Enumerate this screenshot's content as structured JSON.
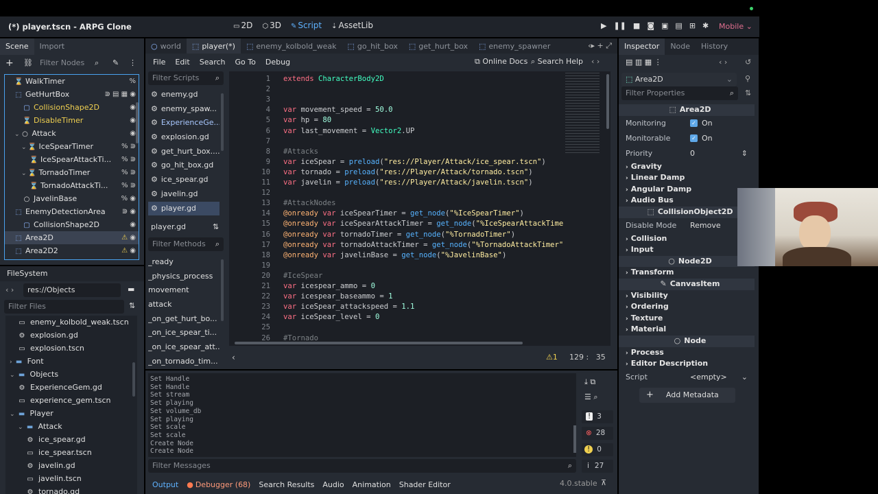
{
  "window": {
    "title": "(*) player.tscn - ARPG Clone"
  },
  "modes": [
    "2D",
    "3D",
    "Script",
    "AssetLib"
  ],
  "active_mode": "Script",
  "renderer": "Mobile",
  "left_tabs": {
    "scene": "Scene",
    "import": "Import"
  },
  "scene_filter": "Filter Nodes",
  "scene_nodes": [
    {
      "label": "WalkTimer",
      "indent": 1,
      "type": "timer",
      "color": "normal",
      "right": "%"
    },
    {
      "label": "GetHurtBox",
      "indent": 1,
      "type": "area",
      "color": "normal",
      "right": "signal sig-group film eye"
    },
    {
      "label": "CollisionShape2D",
      "indent": 2,
      "type": "shape",
      "color": "yellow",
      "right": "eye"
    },
    {
      "label": "DisableTimer",
      "indent": 2,
      "type": "timer",
      "color": "yellow",
      "right": "eye"
    },
    {
      "label": "Attack",
      "indent": 1,
      "type": "node",
      "color": "normal",
      "right": "eye"
    },
    {
      "label": "IceSpearTimer",
      "indent": 2,
      "type": "timer",
      "color": "normal",
      "right": "% signal"
    },
    {
      "label": "IceSpearAttackTi...",
      "indent": 3,
      "type": "timer",
      "color": "normal",
      "right": "% signal"
    },
    {
      "label": "TornadoTimer",
      "indent": 2,
      "type": "timer",
      "color": "normal",
      "right": "% signal"
    },
    {
      "label": "TornadoAttackTi...",
      "indent": 3,
      "type": "timer",
      "color": "normal",
      "right": "% signal"
    },
    {
      "label": "JavelinBase",
      "indent": 2,
      "type": "node",
      "color": "normal",
      "right": "% eye"
    },
    {
      "label": "EnemyDetectionArea",
      "indent": 1,
      "type": "area",
      "color": "normal",
      "right": "signal eye"
    },
    {
      "label": "CollisionShape2D",
      "indent": 2,
      "type": "shape",
      "color": "normal",
      "right": "eye"
    },
    {
      "label": "Area2D",
      "indent": 1,
      "type": "area",
      "color": "normal",
      "right": "warn eye",
      "selected": true
    },
    {
      "label": "Area2D2",
      "indent": 1,
      "type": "area",
      "color": "normal",
      "right": "warn eye"
    }
  ],
  "filesystem": {
    "title": "FileSystem",
    "path": "res://Objects",
    "filter": "Filter Files",
    "items": [
      {
        "label": "enemy_kolbold_weak.tscn",
        "indent": 2,
        "type": "scene"
      },
      {
        "label": "explosion.gd",
        "indent": 2,
        "type": "gear"
      },
      {
        "label": "explosion.tscn",
        "indent": 2,
        "type": "scene"
      },
      {
        "label": "Font",
        "indent": 1,
        "type": "folder",
        "arrow": ">"
      },
      {
        "label": "Objects",
        "indent": 1,
        "type": "folder",
        "arrow": "v"
      },
      {
        "label": "ExperienceGem.gd",
        "indent": 2,
        "type": "gear"
      },
      {
        "label": "experience_gem.tscn",
        "indent": 2,
        "type": "scene"
      },
      {
        "label": "Player",
        "indent": 1,
        "type": "folder",
        "arrow": "v"
      },
      {
        "label": "Attack",
        "indent": 2,
        "type": "folder",
        "arrow": "v"
      },
      {
        "label": "ice_spear.gd",
        "indent": 3,
        "type": "gear"
      },
      {
        "label": "ice_spear.tscn",
        "indent": 3,
        "type": "scene"
      },
      {
        "label": "javelin.gd",
        "indent": 3,
        "type": "gear"
      },
      {
        "label": "javelin.tscn",
        "indent": 3,
        "type": "scene"
      },
      {
        "label": "tornado.gd",
        "indent": 3,
        "type": "gear"
      }
    ]
  },
  "editor_tabs": [
    "world",
    "player(*)",
    "enemy_kolbold_weak",
    "go_hit_box",
    "get_hurt_box",
    "enemy_spawner"
  ],
  "menu": [
    "File",
    "Edit",
    "Search",
    "Go To",
    "Debug"
  ],
  "online_docs": "Online Docs",
  "search_help": "Search Help",
  "filter_scripts": "Filter Scripts",
  "scripts": [
    "enemy.gd",
    "enemy_spaw...",
    "ExperienceGe...",
    "explosion.gd",
    "get_hurt_box....",
    "go_hit_box.gd",
    "ice_spear.gd",
    "javelin.gd",
    "player.gd"
  ],
  "current_script": "player.gd",
  "filter_methods": "Filter Methods",
  "methods": [
    "_ready",
    "_physics_process",
    "movement",
    "attack",
    "_on_get_hurt_bo...",
    "_on_ice_spear_ti...",
    "_on_ice_spear_att...",
    "_on_tornado_tim..."
  ],
  "code_lines": [
    {
      "n": "1",
      "t": [
        [
          "kw",
          "extends "
        ],
        [
          "cls",
          "CharacterBody2D"
        ]
      ]
    },
    {
      "n": "2",
      "t": []
    },
    {
      "n": "3",
      "t": []
    },
    {
      "n": "4",
      "t": [
        [
          "kw",
          "var "
        ],
        [
          "",
          "movement_speed = "
        ],
        [
          "num",
          "50.0"
        ]
      ]
    },
    {
      "n": "5",
      "t": [
        [
          "kw",
          "var "
        ],
        [
          "",
          "hp = "
        ],
        [
          "num",
          "80"
        ]
      ]
    },
    {
      "n": "6",
      "t": [
        [
          "kw",
          "var "
        ],
        [
          "",
          "last_movement = "
        ],
        [
          "cls",
          "Vector2"
        ],
        [
          "",
          ".UP"
        ]
      ]
    },
    {
      "n": "7",
      "t": []
    },
    {
      "n": "8",
      "t": [
        [
          "cm",
          "#Attacks"
        ]
      ]
    },
    {
      "n": "9",
      "t": [
        [
          "kw",
          "var "
        ],
        [
          "",
          "iceSpear = "
        ],
        [
          "fn",
          "preload"
        ],
        [
          "",
          "("
        ],
        [
          "str",
          "\"res://Player/Attack/ice_spear.tscn\""
        ],
        [
          "",
          ")"
        ]
      ]
    },
    {
      "n": "10",
      "t": [
        [
          "kw",
          "var "
        ],
        [
          "",
          "tornado = "
        ],
        [
          "fn",
          "preload"
        ],
        [
          "",
          "("
        ],
        [
          "str",
          "\"res://Player/Attack/tornado.tscn\""
        ],
        [
          "",
          ")"
        ]
      ]
    },
    {
      "n": "11",
      "t": [
        [
          "kw",
          "var "
        ],
        [
          "",
          "javelin = "
        ],
        [
          "fn",
          "preload"
        ],
        [
          "",
          "("
        ],
        [
          "str",
          "\"res://Player/Attack/javelin.tscn\""
        ],
        [
          "",
          ")"
        ]
      ]
    },
    {
      "n": "12",
      "t": []
    },
    {
      "n": "13",
      "t": [
        [
          "cm",
          "#AttackNodes"
        ]
      ]
    },
    {
      "n": "14",
      "t": [
        [
          "anno",
          "@onready "
        ],
        [
          "kw",
          "var "
        ],
        [
          "",
          "iceSpearTimer = "
        ],
        [
          "fn",
          "get_node"
        ],
        [
          "",
          "("
        ],
        [
          "str",
          "\"%IceSpearTimer\""
        ],
        [
          "",
          ")"
        ]
      ]
    },
    {
      "n": "15",
      "t": [
        [
          "anno",
          "@onready "
        ],
        [
          "kw",
          "var "
        ],
        [
          "",
          "iceSpearAttackTimer = "
        ],
        [
          "fn",
          "get_node"
        ],
        [
          "",
          "("
        ],
        [
          "str",
          "\"%IceSpearAttackTime"
        ]
      ]
    },
    {
      "n": "16",
      "t": [
        [
          "anno",
          "@onready "
        ],
        [
          "kw",
          "var "
        ],
        [
          "",
          "tornadoTimer = "
        ],
        [
          "fn",
          "get_node"
        ],
        [
          "",
          "("
        ],
        [
          "str",
          "\"%TornadoTimer\""
        ],
        [
          "",
          ")"
        ]
      ]
    },
    {
      "n": "17",
      "t": [
        [
          "anno",
          "@onready "
        ],
        [
          "kw",
          "var "
        ],
        [
          "",
          "tornadoAttackTimer = "
        ],
        [
          "fn",
          "get_node"
        ],
        [
          "",
          "("
        ],
        [
          "str",
          "\"%TornadoAttackTimer\""
        ]
      ]
    },
    {
      "n": "18",
      "t": [
        [
          "anno",
          "@onready "
        ],
        [
          "kw",
          "var "
        ],
        [
          "",
          "javelinBase = "
        ],
        [
          "fn",
          "get_node"
        ],
        [
          "",
          "("
        ],
        [
          "str",
          "\"%JavelinBase\""
        ],
        [
          "",
          ")"
        ]
      ]
    },
    {
      "n": "19",
      "t": []
    },
    {
      "n": "20",
      "t": [
        [
          "cm",
          "#IceSpear"
        ]
      ]
    },
    {
      "n": "21",
      "t": [
        [
          "kw",
          "var "
        ],
        [
          "",
          "icespear_ammo = "
        ],
        [
          "num",
          "0"
        ]
      ]
    },
    {
      "n": "22",
      "t": [
        [
          "kw",
          "var "
        ],
        [
          "",
          "icespear_baseammo = "
        ],
        [
          "num",
          "1"
        ]
      ]
    },
    {
      "n": "23",
      "t": [
        [
          "kw",
          "var "
        ],
        [
          "",
          "iceSpear_attackspeed = "
        ],
        [
          "num",
          "1.1"
        ]
      ]
    },
    {
      "n": "24",
      "t": [
        [
          "kw",
          "var "
        ],
        [
          "",
          "iceSpear_level = "
        ],
        [
          "num",
          "0"
        ]
      ]
    },
    {
      "n": "25",
      "t": []
    },
    {
      "n": "26",
      "t": [
        [
          "cm",
          "#Tornado"
        ]
      ]
    }
  ],
  "status": {
    "warnings": "1",
    "line": "129",
    "col": "35"
  },
  "output_lines": [
    "Set Handle",
    "Set Handle",
    "Set stream",
    "Set playing",
    "Set volume_db",
    "Set playing",
    "Set scale",
    "Set scale",
    "Create Node",
    "Create Node"
  ],
  "filter_messages": "Filter Messages",
  "counts": {
    "errors": "3",
    "err2": "28",
    "warn": "0",
    "info": "27"
  },
  "bottom_tabs": [
    "Output",
    "Debugger (68)",
    "Search Results",
    "Audio",
    "Animation",
    "Shader Editor"
  ],
  "version": "4.0.stable",
  "inspector": {
    "tabs": [
      "Inspector",
      "Node",
      "History"
    ],
    "object": "Area2D",
    "filter": "Filter Properties",
    "area_header": "Area2D",
    "monitoring_label": "Monitoring",
    "monitoring_value": "On",
    "monitorable_label": "Monitorable",
    "monitorable_value": "On",
    "priority_label": "Priority",
    "priority_value": "0",
    "sections1": [
      "Gravity",
      "Linear Damp",
      "Angular Damp",
      "Audio Bus"
    ],
    "collision_header": "CollisionObject2D",
    "disable_mode_label": "Disable Mode",
    "disable_mode_value": "Remove",
    "sections2": [
      "Collision",
      "Input"
    ],
    "node2d_header": "Node2D",
    "sections3": [
      "Transform"
    ],
    "canvas_header": "CanvasItem",
    "sections4": [
      "Visibility",
      "Ordering",
      "Texture",
      "Material"
    ],
    "node_header": "Node",
    "sections5": [
      "Process",
      "Editor Description"
    ],
    "script_label": "Script",
    "script_value": "<empty>",
    "add_metadata": "Add Metadata"
  }
}
